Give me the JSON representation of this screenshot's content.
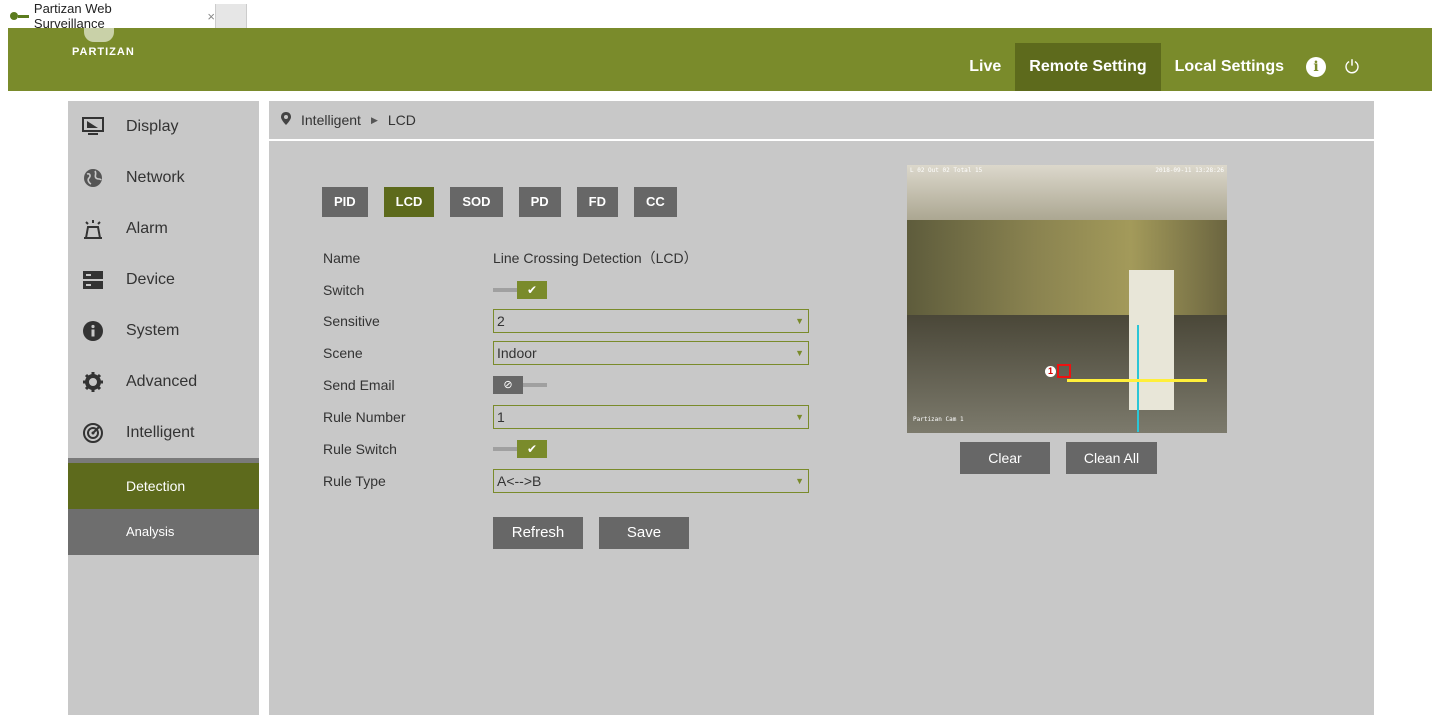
{
  "browser": {
    "tab_title": "Partizan Web Surveillance",
    "tab_close": "×"
  },
  "header": {
    "logo_text": "PARTIZAN",
    "nav": [
      {
        "label": "Live",
        "active": false
      },
      {
        "label": "Remote Setting",
        "active": true
      },
      {
        "label": "Local Settings",
        "active": false
      }
    ],
    "info_glyph": "i",
    "power_glyph": "⏻",
    "accent_color": "#7a8b2b"
  },
  "sidebar": {
    "items": [
      {
        "label": "Display",
        "icon": "monitor-icon"
      },
      {
        "label": "Network",
        "icon": "globe-icon"
      },
      {
        "label": "Alarm",
        "icon": "alarm-icon"
      },
      {
        "label": "Device",
        "icon": "device-icon"
      },
      {
        "label": "System",
        "icon": "info-circle-icon"
      },
      {
        "label": "Advanced",
        "icon": "gear-icon"
      },
      {
        "label": "Intelligent",
        "icon": "intelligent-icon"
      }
    ],
    "subitems": [
      {
        "label": "Detection",
        "active": true
      },
      {
        "label": "Analysis",
        "active": false
      }
    ]
  },
  "breadcrumb": {
    "root": "Intelligent",
    "current": "LCD"
  },
  "tabs": [
    {
      "label": "PID",
      "active": false
    },
    {
      "label": "LCD",
      "active": true
    },
    {
      "label": "SOD",
      "active": false
    },
    {
      "label": "PD",
      "active": false
    },
    {
      "label": "FD",
      "active": false
    },
    {
      "label": "CC",
      "active": false
    }
  ],
  "form": {
    "name_label": "Name",
    "name_value": "Line Crossing Detection（LCD）",
    "switch_label": "Switch",
    "switch_on": true,
    "sensitive_label": "Sensitive",
    "sensitive_value": "2",
    "scene_label": "Scene",
    "scene_value": "Indoor",
    "send_email_label": "Send Email",
    "send_email_on": false,
    "rule_number_label": "Rule Number",
    "rule_number_value": "1",
    "rule_switch_label": "Rule Switch",
    "rule_switch_on": true,
    "rule_type_label": "Rule Type",
    "rule_type_value": "A<-->B",
    "refresh_label": "Refresh",
    "save_label": "Save"
  },
  "preview": {
    "osd_top_left": "L 02 Out 02 Total 15",
    "osd_top_right": "2018-09-11 13:28:26",
    "osd_bottom": "Partizan Cam 1",
    "rule_marker": "1",
    "clear_label": "Clear",
    "clean_all_label": "Clean All"
  }
}
